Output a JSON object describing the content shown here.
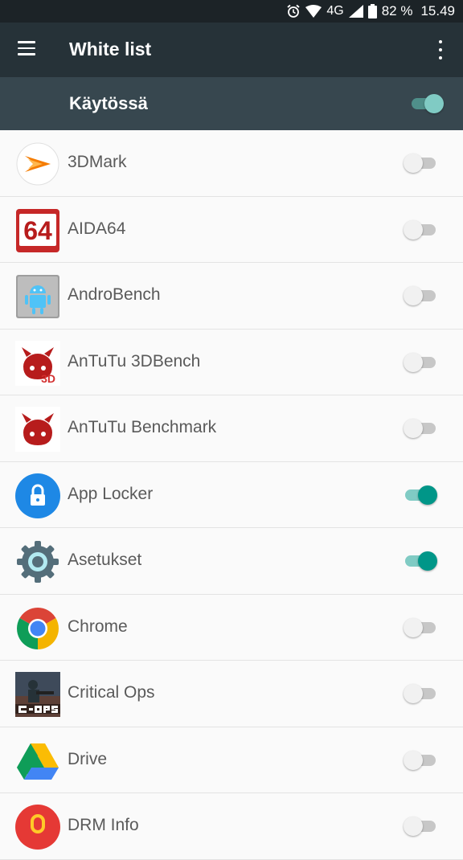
{
  "status_bar": {
    "network": "4G",
    "battery": "82 %",
    "time": "15.49"
  },
  "app_bar": {
    "title": "White list"
  },
  "master_toggle": {
    "label": "Käytössä",
    "enabled": true
  },
  "apps": [
    {
      "name": "3DMark",
      "icon": "3dmark-icon",
      "enabled": false
    },
    {
      "name": "AIDA64",
      "icon": "aida64-icon",
      "enabled": false
    },
    {
      "name": "AndroBench",
      "icon": "androbench-icon",
      "enabled": false
    },
    {
      "name": "AnTuTu 3DBench",
      "icon": "antutu-3dbench-icon",
      "enabled": false
    },
    {
      "name": "AnTuTu Benchmark",
      "icon": "antutu-benchmark-icon",
      "enabled": false
    },
    {
      "name": "App Locker",
      "icon": "app-locker-icon",
      "enabled": true
    },
    {
      "name": "Asetukset",
      "icon": "settings-gear-icon",
      "enabled": true
    },
    {
      "name": "Chrome",
      "icon": "chrome-icon",
      "enabled": false
    },
    {
      "name": "Critical Ops",
      "icon": "critical-ops-icon",
      "enabled": false
    },
    {
      "name": "Drive",
      "icon": "drive-icon",
      "enabled": false
    },
    {
      "name": "DRM Info",
      "icon": "drm-info-icon",
      "enabled": false
    }
  ],
  "colors": {
    "accent": "#009688",
    "accent_light": "#80cbc4",
    "app_bar": "#263238",
    "master_bar": "#37474f",
    "status_bar": "#1c2327"
  }
}
